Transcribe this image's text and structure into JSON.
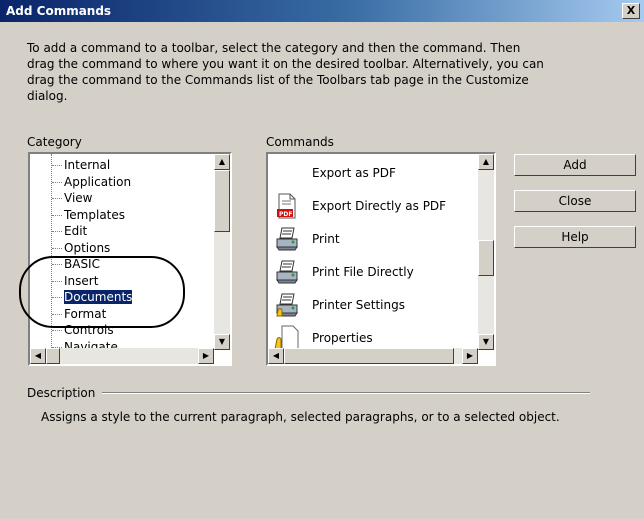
{
  "window": {
    "title": "Add Commands",
    "close_label": "X"
  },
  "intro_text": "To add a command to a toolbar, select the category and then the command. Then drag the command to where you want it on the desired toolbar. Alternatively, you can drag the command to the Commands list of the Toolbars tab page in the Customize dialog.",
  "category": {
    "label": "Category",
    "items": [
      "Internal",
      "Application",
      "View",
      "Templates",
      "Edit",
      "Options",
      "BASIC",
      "Insert",
      "Documents",
      "Format",
      "Controls",
      "Navigate"
    ],
    "selected": "Documents"
  },
  "commands": {
    "label": "Commands",
    "items": [
      {
        "label": "Export as PDF",
        "icon": "export-pdf-icon"
      },
      {
        "label": "Export Directly as PDF",
        "icon": "pdf-document-icon"
      },
      {
        "label": "Print",
        "icon": "printer-icon"
      },
      {
        "label": "Print File Directly",
        "icon": "printer-icon"
      },
      {
        "label": "Printer Settings",
        "icon": "printer-settings-icon"
      },
      {
        "label": "Properties",
        "icon": "properties-icon"
      }
    ]
  },
  "buttons": {
    "add": "Add",
    "close": "Close",
    "help": "Help"
  },
  "description": {
    "label": "Description",
    "text": "Assigns a style to the current paragraph, selected paragraphs, or to a selected object."
  },
  "colors": {
    "title_start": "#0a246a",
    "selection": "#0a246a"
  }
}
